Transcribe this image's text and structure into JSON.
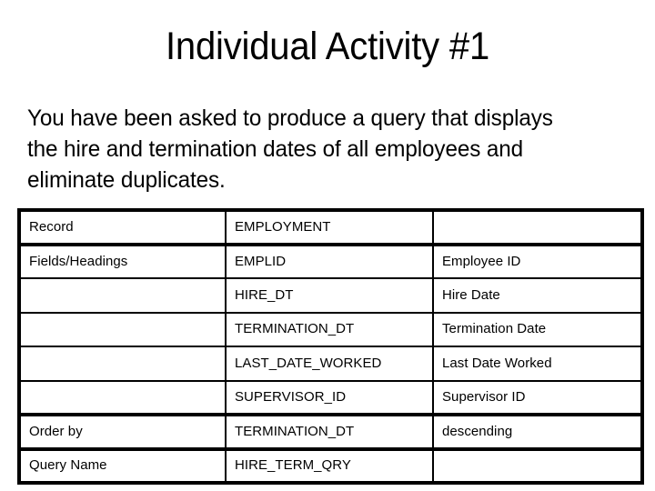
{
  "slide": {
    "title": "Individual Activity #1",
    "body_lines": [
      "You have been asked to produce a query that displays",
      "the hire and termination dates of all employees and",
      "eliminate duplicates."
    ]
  },
  "table": {
    "columns": 3,
    "rows": [
      {
        "label": "Record",
        "field": "EMPLOYMENT",
        "description": ""
      },
      {
        "label": "Fields/Headings",
        "field": "EMPLID",
        "description": "Employee ID"
      },
      {
        "label": "",
        "field": "HIRE_DT",
        "description": "Hire Date"
      },
      {
        "label": "",
        "field": "TERMINATION_DT",
        "description": "Termination Date"
      },
      {
        "label": "",
        "field": "LAST_DATE_WORKED",
        "description": "Last Date Worked"
      },
      {
        "label": "",
        "field": "SUPERVISOR_ID",
        "description": "Supervisor ID"
      },
      {
        "label": "Order by",
        "field": "TERMINATION_DT",
        "description": "descending"
      },
      {
        "label": "Query Name",
        "field": "HIRE_TERM_QRY",
        "description": ""
      }
    ]
  },
  "colors": {
    "background": "#ffffff",
    "text": "#000000",
    "border": "#000000"
  }
}
